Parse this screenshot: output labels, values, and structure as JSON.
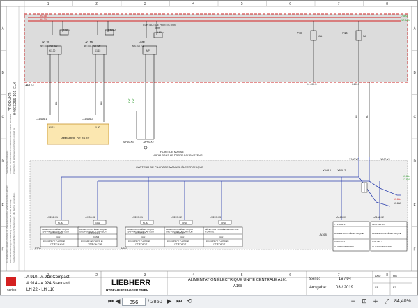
{
  "sheet": {
    "column_numbers": [
      "1",
      "2",
      "3",
      "4",
      "5",
      "6",
      "7",
      "8"
    ],
    "row_letters": [
      "A",
      "B",
      "C",
      "D",
      "E",
      "F"
    ],
    "product_label": "PRODUKT:",
    "product_id": "94693255-101-ELX",
    "side_texts": [
      "Die Wiedergabe dieser Unterlage ist ohne ausdrückliche Genehmigung der Liebherr",
      "sowie die Verwertung und Mitteilung ihres Inhalts, an Dritte untersagt.",
      "Zuwiderhandlungen verpflichten zu Schadenersatz. Alle Rechte vorbehalten.",
      "Patentschutz eingetragen.",
      "In case of this document is not allowed without explicit permission",
      "of Liebherr. All rights reserved. Patents applied for."
    ]
  },
  "diagram": {
    "rails": [
      "KL58",
      "KL30"
    ],
    "rail_refs": [
      "7.8A1",
      "17.8A1"
    ],
    "box_main_label": "-A161",
    "box_protection_title": "CONTACT DE PROTECTION",
    "box_protection_sub": "5mm",
    "relay_kl30": "-KL30",
    "relay_kl15": "-KL15",
    "relay_mp": "-MP",
    "relay_sub_labels": [
      "NR 400 / NR 400",
      "NR 400 / NR 400",
      "MS 400 / 02"
    ],
    "relay_contacts": [
      "K1.30",
      "K1.30",
      "K1.15",
      "K1.15",
      "MP",
      "MP"
    ],
    "fuse_labels": [
      "-F18",
      "-F16"
    ],
    "fuse_values": [
      "15A",
      "5A"
    ],
    "conn_small_labels": [
      "X400:3",
      "X4 400:S",
      "X400:2",
      "X400:5",
      "X400:4",
      "X400:8"
    ],
    "wire_labels": [
      "BL",
      "BN",
      "BN",
      "BK",
      "BK",
      "BN",
      "BN",
      "SW"
    ],
    "x_refs_left": [
      "-X1416.1",
      "-X1416.2",
      "-X6"
    ],
    "gnd_green_labels": [
      "EXT",
      "EXT",
      "GND"
    ],
    "ground_refs": [
      "-MP60.X3",
      "-MP60.X2",
      "-MP60.X1"
    ],
    "ground_label": "POINT DE MASSE",
    "ground_sub": "-MP60 SOUS LE POSTE CONDUCTEUR",
    "appareil_label": "APPAREIL DE BASE",
    "appareil_pins": [
      "KL15",
      "KL30"
    ],
    "capteur_title": "CAPTEUR DE PILOTAGE MANUEL ÉLECTRONIQUE",
    "capteur_box_ref": "-X548.1",
    "capteur_box_ref2": "-X548.2",
    "capteur_right_refs": [
      "-X160.X7",
      "-X160.X8"
    ],
    "capteur_green_refs": [
      "17.8A4",
      "17.8A5"
    ],
    "connectors_bottom": [
      {
        "ref": "-X206.X1",
        "pin": "KL30",
        "desc1": "ALIMENTATION ÉLECTRIQUE",
        "desc2": "+24V POIGNÉE DE CAPTEUR",
        "desc3": "CÔTÉ GAUCHE",
        "can": "CAN 3",
        "pos1": "POIGNÉE DE CAPTEUR",
        "pos2": "CÔTÉ GAUCHE"
      },
      {
        "ref": "-X206.X2",
        "pin": "GND",
        "desc1": "ALIMENTATION ÉLECTRIQUE",
        "desc2": "GND POIGNÉE DE CAPTEUR",
        "desc3": "CÔTÉ GAUCHE",
        "can": "CAN 3",
        "pos1": "POIGNÉE DE CAPTEUR",
        "pos2": "CÔTÉ GAUCHE"
      },
      {
        "ref": "-X207.X1",
        "pin": "KL30",
        "desc1": "ALIMENTATION ÉLECTRIQUE",
        "desc2": "+24V POIGNÉE DE CAPTEUR",
        "desc3": "CÔTÉ DROIT",
        "can": "CAN 3",
        "pos1": "POIGNÉE DE CAPTEUR",
        "pos2": "CÔTÉ DROIT"
      },
      {
        "ref": "-X207.X2",
        "pin": "GND",
        "desc1": "ALIMENTATION ÉLECTRIQUE",
        "desc2": "GND POIGNÉE DE CAPTEUR",
        "desc3": "CÔTÉ DROIT",
        "can": "CAN 3",
        "pos1": "POIGNÉE DE CAPTEUR",
        "pos2": "CÔTÉ DROIT"
      },
      {
        "ref": "-X207.X3",
        "pin": "GND",
        "desc1": "DÉTECTION POIGNÉE DE CAPTEUR",
        "desc2": "À DROITE",
        "desc3": "",
        "can": "CAN 3",
        "pos1": "POIGNÉE DE CAPTEUR",
        "pos2": "CÔTÉ DROIT"
      }
    ],
    "a_refs_bottom": [
      "-A205",
      "-A207"
    ],
    "right_refs_bottom": [
      "-X160.X1",
      "-X160.X2",
      "-A168"
    ],
    "right_bottom_boxes": [
      {
        "ref": "-A168.X1",
        "t1": "TYPE/NR.1",
        "t2": "ALIMENTATION ÉLECTRIQUE",
        "t3": "CAN-NR. 2",
        "t4": "CLAVIER PRINCIPAL"
      },
      {
        "ref": "-A168.X2",
        "t1": "MOD.-NR. 87",
        "t2": "ALIMENTATION ÉLECTRIQUE",
        "t3": "CAN-NR. 3",
        "t4": "CLAVIER PRINCIPAL"
      }
    ],
    "left_refs_x": [
      "-X500.X1",
      "-X500.X2"
    ]
  },
  "title_block": {
    "models_line1": "A 910 - A 918 Compact",
    "models_line2": "A 914 - A 924 Standard",
    "models_line3": "LH 22 - LH 110",
    "brand": "LIEBHERR",
    "brand_sub": "HYDRAULIKBAGGER GMBH",
    "title": "ALIMENTATION ÉLECTRIQUE UNITÉ CENTRALE A161",
    "subtitle": "A168",
    "seite_label": "Seite:",
    "seite_value": "- 16  / 94",
    "ausgabe_label": "Ausgabe:",
    "ausgabe_value": "03 / 2019",
    "rev_cells": [
      "AND",
      "HG",
      "SS",
      "FZ"
    ],
    "series_label": "series"
  },
  "viewer": {
    "page_value": "856",
    "page_total": "/ 2850",
    "zoom": "84,40%"
  }
}
